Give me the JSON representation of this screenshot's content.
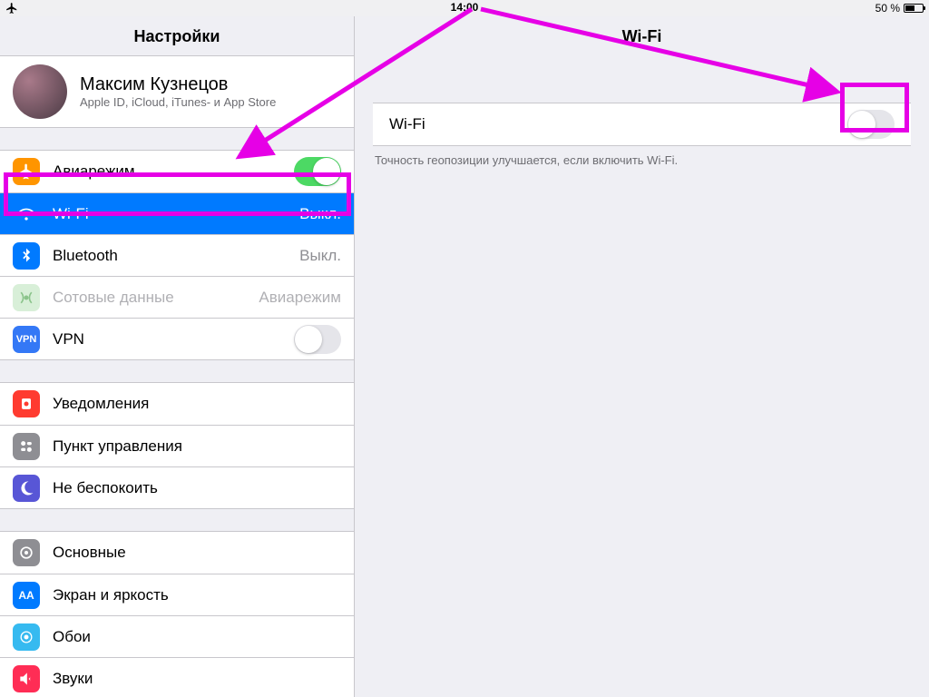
{
  "status": {
    "time": "14:00",
    "battery_label": "50 %"
  },
  "sidebar": {
    "title": "Настройки",
    "profile": {
      "name": "Максим Кузнецов",
      "sub": "Apple ID, iCloud, iTunes- и App Store"
    },
    "group1": {
      "airplane": "Авиарежим",
      "wifi_label": "Wi-Fi",
      "wifi_value": "Выкл.",
      "bluetooth_label": "Bluetooth",
      "bluetooth_value": "Выкл.",
      "cellular_label": "Сотовые данные",
      "cellular_value": "Авиарежим",
      "vpn": "VPN"
    },
    "group2": {
      "notifications": "Уведомления",
      "controlcenter": "Пункт управления",
      "dnd": "Не беспокоить"
    },
    "group3": {
      "general": "Основные",
      "display": "Экран и яркость",
      "wallpaper": "Обои",
      "sounds": "Звуки"
    }
  },
  "detail": {
    "title": "Wi-Fi",
    "wifi_row_label": "Wi-Fi",
    "footer": "Точность геопозиции улучшается, если включить Wi-Fi."
  },
  "colors": {
    "accent": "#007aff",
    "highlight": "#e600e6",
    "toggle_on": "#4cd964"
  }
}
